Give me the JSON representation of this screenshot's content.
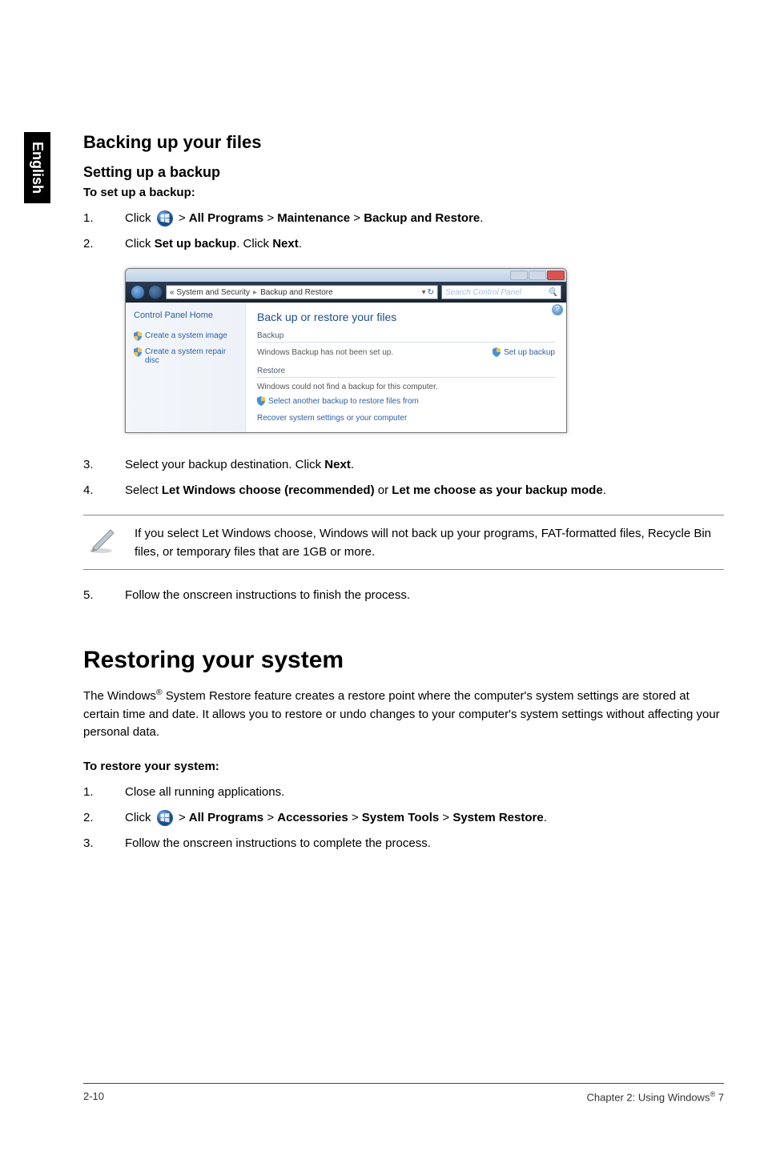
{
  "language": "English",
  "section1": {
    "title": "Backing up your files",
    "subtitle": "Setting up a backup",
    "lead": "To set up a backup:",
    "steps": [
      {
        "num": "1.",
        "prefix": "Click ",
        "path_parts": [
          "All Programs",
          "Maintenance",
          "Backup and Restore"
        ],
        "suffix": "."
      },
      {
        "num": "2.",
        "text_parts": [
          [
            "Click ",
            false
          ],
          [
            "Set up backup",
            true
          ],
          [
            ". Click ",
            false
          ],
          [
            "Next",
            true
          ],
          [
            ".",
            false
          ]
        ]
      }
    ],
    "steps_after": [
      {
        "num": "3.",
        "text_parts": [
          [
            "Select your backup destination. Click ",
            false
          ],
          [
            "Next",
            true
          ],
          [
            ".",
            false
          ]
        ]
      },
      {
        "num": "4.",
        "text_parts": [
          [
            "Select ",
            false
          ],
          [
            "Let Windows choose (recommended)",
            true
          ],
          [
            " or ",
            false
          ],
          [
            "Let me choose as your backup mode",
            true
          ],
          [
            ".",
            false
          ]
        ]
      }
    ],
    "note": {
      "parts": [
        [
          "If you select ",
          false
        ],
        [
          "Let Windows choose",
          true
        ],
        [
          ", Windows will not back up your programs, FAT-formatted files, Recycle Bin files, or temporary files that are 1GB or more.",
          false
        ]
      ]
    },
    "step5": {
      "num": "5.",
      "text": "Follow the onscreen instructions to finish the process."
    }
  },
  "screenshot": {
    "breadcrumb_icon_tip": "System and Security",
    "breadcrumb_parts": [
      "« System and Security",
      "Backup and Restore"
    ],
    "search_placeholder": "Search Control Panel",
    "left": {
      "home": "Control Panel Home",
      "task1": "Create a system image",
      "task2": "Create a system repair disc"
    },
    "right": {
      "title": "Back up or restore your files",
      "backup_label": "Backup",
      "backup_msg": "Windows Backup has not been set up.",
      "backup_action": "Set up backup",
      "restore_label": "Restore",
      "restore_msg": "Windows could not find a backup for this computer.",
      "restore_link": "Select another backup to restore files from",
      "recover_link": "Recover system settings or your computer"
    }
  },
  "section2": {
    "title": "Restoring your system",
    "para_parts": [
      "The Windows",
      "®",
      " System Restore feature creates a restore point where the computer's system settings are stored at certain time and date. It allows you to restore or undo changes to your computer's system settings without affecting your personal data."
    ],
    "lead": "To restore your system:",
    "steps": [
      {
        "num": "1.",
        "text": "Close all running applications."
      },
      {
        "num": "2.",
        "prefix": "Click ",
        "path_parts": [
          "All Programs",
          "Accessories",
          "System Tools",
          "System Restore"
        ],
        "suffix": "."
      },
      {
        "num": "3.",
        "text": "Follow the onscreen instructions to complete the process."
      }
    ]
  },
  "footer": {
    "left": "2-10",
    "right_prefix": "Chapter 2: Using Windows",
    "right_sup": "®",
    "right_suffix": " 7"
  }
}
